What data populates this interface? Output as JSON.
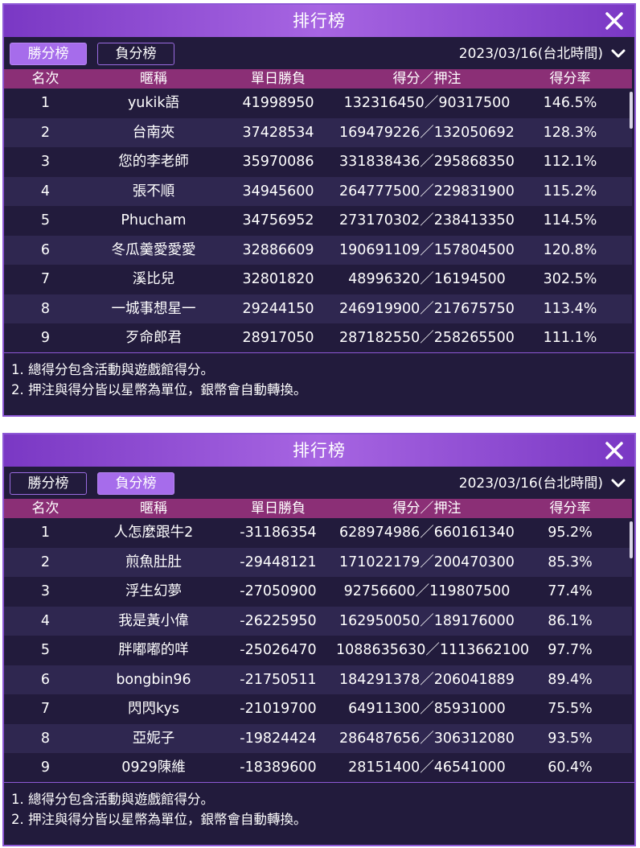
{
  "panels": [
    {
      "title": "排行榜",
      "tabs": [
        {
          "label": "勝分榜",
          "active": true
        },
        {
          "label": "負分榜",
          "active": false
        }
      ],
      "date": "2023/03/16(台北時間)",
      "headers": {
        "rank": "名次",
        "name": "暱稱",
        "daily": "單日勝負",
        "score": "得分／押注",
        "rate": "得分率"
      },
      "rows": [
        {
          "rank": "1",
          "name": "yukik語",
          "daily": "41998950",
          "score": "132316450／90317500",
          "rate": "146.5%"
        },
        {
          "rank": "2",
          "name": "台南夾",
          "daily": "37428534",
          "score": "169479226／132050692",
          "rate": "128.3%"
        },
        {
          "rank": "3",
          "name": "您的李老師",
          "daily": "35970086",
          "score": "331838436／295868350",
          "rate": "112.1%"
        },
        {
          "rank": "4",
          "name": "張不順",
          "daily": "34945600",
          "score": "264777500／229831900",
          "rate": "115.2%"
        },
        {
          "rank": "5",
          "name": "Phucham",
          "daily": "34756952",
          "score": "273170302／238413350",
          "rate": "114.5%"
        },
        {
          "rank": "6",
          "name": "冬瓜羹愛愛愛",
          "daily": "32886609",
          "score": "190691109／157804500",
          "rate": "120.8%"
        },
        {
          "rank": "7",
          "name": "溪比兒",
          "daily": "32801820",
          "score": "48996320／16194500",
          "rate": "302.5%"
        },
        {
          "rank": "8",
          "name": "一城事想星一",
          "daily": "29244150",
          "score": "246919900／217675750",
          "rate": "113.4%"
        },
        {
          "rank": "9",
          "name": "歹命郎君",
          "daily": "28917050",
          "score": "287182550／258265500",
          "rate": "111.1%"
        }
      ],
      "notes": [
        "1. 總得分包含活動與遊戲館得分。",
        "2. 押注與得分皆以星幣為單位，銀幣會自動轉換。"
      ]
    },
    {
      "title": "排行榜",
      "tabs": [
        {
          "label": "勝分榜",
          "active": false
        },
        {
          "label": "負分榜",
          "active": true
        }
      ],
      "date": "2023/03/16(台北時間)",
      "headers": {
        "rank": "名次",
        "name": "暱稱",
        "daily": "單日勝負",
        "score": "得分／押注",
        "rate": "得分率"
      },
      "rows": [
        {
          "rank": "1",
          "name": "人怎麼跟牛2",
          "daily": "-31186354",
          "score": "628974986／660161340",
          "rate": "95.2%"
        },
        {
          "rank": "2",
          "name": "煎魚肚肚",
          "daily": "-29448121",
          "score": "171022179／200470300",
          "rate": "85.3%"
        },
        {
          "rank": "3",
          "name": "浮生幻夢",
          "daily": "-27050900",
          "score": "92756600／119807500",
          "rate": "77.4%"
        },
        {
          "rank": "4",
          "name": "我是黃小偉",
          "daily": "-26225950",
          "score": "162950050／189176000",
          "rate": "86.1%"
        },
        {
          "rank": "5",
          "name": "胖嘟嘟的咩",
          "daily": "-25026470",
          "score": "1088635630／1113662100",
          "rate": "97.7%"
        },
        {
          "rank": "6",
          "name": "bongbin96",
          "daily": "-21750511",
          "score": "184291378／206041889",
          "rate": "89.4%"
        },
        {
          "rank": "7",
          "name": "閃閃kys",
          "daily": "-21019700",
          "score": "64911300／85931000",
          "rate": "75.5%"
        },
        {
          "rank": "8",
          "name": "亞妮子",
          "daily": "-19824424",
          "score": "286487656／306312080",
          "rate": "93.5%"
        },
        {
          "rank": "9",
          "name": "0929陳維",
          "daily": "-18389600",
          "score": "28151400／46541000",
          "rate": "60.4%"
        }
      ],
      "notes": [
        "1. 總得分包含活動與遊戲館得分。",
        "2. 押注與得分皆以星幣為單位，銀幣會自動轉換。"
      ]
    }
  ],
  "colors": {
    "panel_bg": "#221b3c",
    "row_alt_bg": "#2f2750",
    "header_row_bg": "#8b2f76",
    "title_bar": "#a765e2",
    "active_tab": "#a66ceb",
    "border": "#8e59d6"
  },
  "icons": {
    "close": "close-x-icon",
    "dropdown": "chevron-down-icon"
  }
}
